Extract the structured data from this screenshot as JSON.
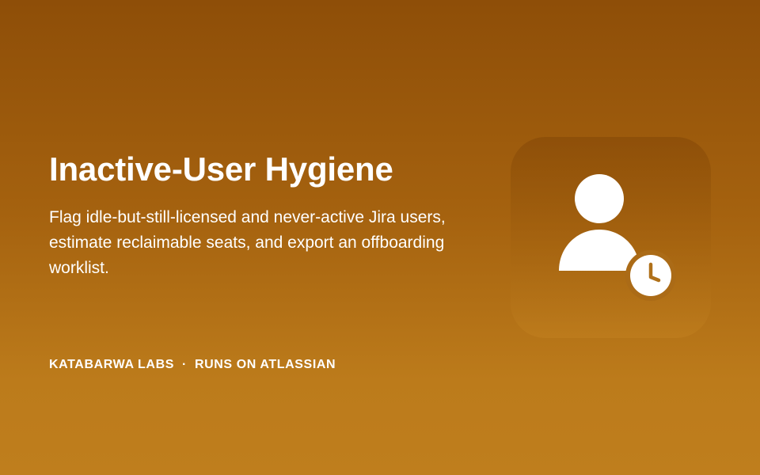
{
  "card": {
    "title": "Inactive-User Hygiene",
    "description": "Flag idle-but-still-licensed and never-active Jira users, estimate reclaimable seats, and export an offboarding worklist.",
    "publisher": "KATABARWA LABS",
    "separator": "·",
    "platform": "RUNS ON ATLASSIAN"
  },
  "icon": {
    "name": "user-clock-icon"
  },
  "colors": {
    "background_top": "#8E4E08",
    "background_bottom": "#BF7E1D",
    "foreground": "#FFFFFF"
  }
}
